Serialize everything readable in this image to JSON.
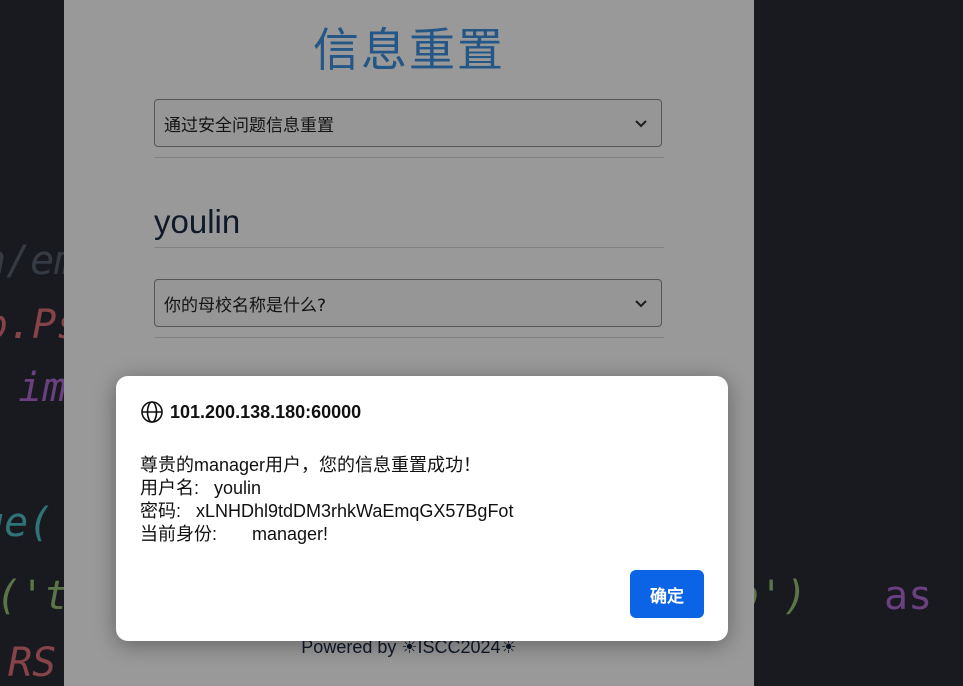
{
  "background_code": {
    "lines": [
      {
        "text": "n/em",
        "color": "#5a6270"
      },
      {
        "text": "o.Ps",
        "color": "#e0707a"
      },
      {
        "text": "  im",
        "color": "#b16cd8"
      },
      {
        "text": "ge(",
        "color": "#4fc1c9"
      },
      {
        "text": "('t",
        "color": "#98c379"
      },
      {
        "text": "RS",
        "color": "#e0707a"
      }
    ],
    "right_text": {
      "b_quote": "b')",
      "as_kw": "as"
    }
  },
  "page": {
    "title": "信息重置",
    "reset_method_select": {
      "value": "通过安全问题信息重置"
    },
    "username": "youlin",
    "security_question_select": {
      "value": "你的母校名称是什么?"
    },
    "footer": "Powered by ☀ISCC2024☀"
  },
  "dialog": {
    "origin": "101.200.138.180:60000",
    "message_lines": [
      "尊贵的manager用户，您的信息重置成功！",
      "用户名:   youlin",
      "密码:   xLNHDhl9tdDM3rhkWaEmqGX57BgFot",
      "当前身份:       manager!"
    ],
    "ok_label": "确定"
  },
  "colors": {
    "accent": "#0b63e5",
    "title": "#3d8fe0",
    "editor_bg": "#2a2c35"
  }
}
